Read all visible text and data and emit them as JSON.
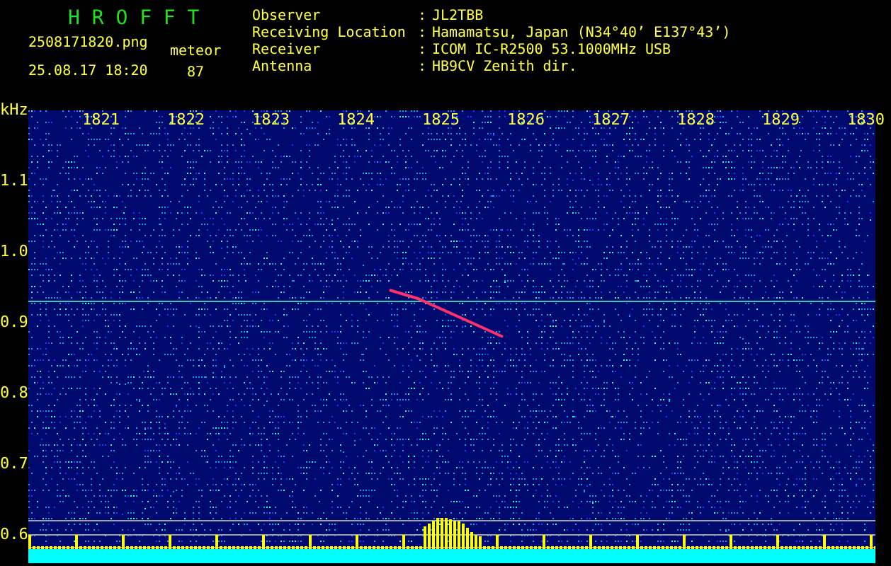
{
  "title": "H R O F F T",
  "file": {
    "name": "2508171820.png",
    "datetime": "25.08.17 18:20"
  },
  "counter": {
    "label": "meteor",
    "value": "87"
  },
  "station": [
    {
      "label": "Observer",
      "value": "JL2TBB"
    },
    {
      "label": "Receiving Location",
      "value": "Hamamatsu, Japan (N34°40’ E137°43’)"
    },
    {
      "label": "Receiver",
      "value": "ICOM IC-R2500 53.1000MHz USB"
    },
    {
      "label": "Antenna",
      "value": "HB9CV Zenith dir."
    }
  ],
  "separator": ":",
  "freq_axis": {
    "unit": "kHz",
    "labels": [
      "1.1",
      "1.0",
      "0.9",
      "0.8",
      "0.7",
      "0.6"
    ]
  },
  "time_axis": {
    "labels": [
      "1821",
      "1822",
      "1823",
      "1824",
      "1825",
      "1826",
      "1827",
      "1828",
      "1829",
      "1830"
    ]
  }
}
